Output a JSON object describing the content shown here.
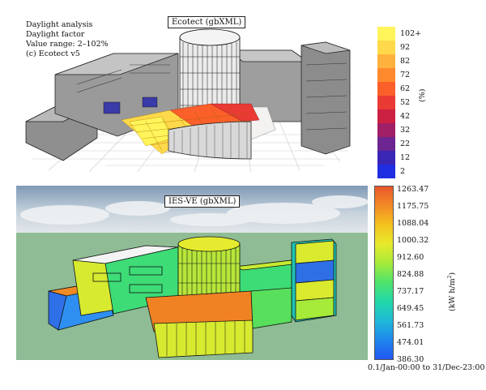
{
  "ecotect": {
    "title": "Ecotect (gbXML)",
    "info_lines": [
      "Daylight analysis",
      "Daylight factor",
      "Value range: 2–102%",
      "(c) Ecotect v5"
    ],
    "legend": [
      {
        "label": "102+",
        "color": "#fff45a"
      },
      {
        "label": "92",
        "color": "#ffd94a"
      },
      {
        "label": "82",
        "color": "#ffb13d"
      },
      {
        "label": "72",
        "color": "#ff8a2e"
      },
      {
        "label": "62",
        "color": "#fb5f2a"
      },
      {
        "label": "52",
        "color": "#ea3a34"
      },
      {
        "label": "42",
        "color": "#cc2143"
      },
      {
        "label": "32",
        "color": "#a01f66"
      },
      {
        "label": "22",
        "color": "#6c2591"
      },
      {
        "label": "12",
        "color": "#3a26b5"
      },
      {
        "label": "2",
        "color": "#1f2ee0"
      }
    ],
    "unit": "(%)"
  },
  "iesve": {
    "title": "IES-VE (gbXML)",
    "scale": [
      "1263.47",
      "1175.75",
      "1088.04",
      "1000.32",
      "912.60",
      "824.88",
      "737.17",
      "649.45",
      "561.73",
      "474.01",
      "386.30"
    ],
    "unit_base": "(kW h/m",
    "unit_sup": "2",
    "unit_end": ")",
    "time_range": "0.1/Jan-00:00 to 31/Dec-23:00",
    "gradient_colors": [
      "#e8572a",
      "#f28a25",
      "#f4c21e",
      "#e6ea2b",
      "#a6ea3a",
      "#4fe36b",
      "#22d8a8",
      "#1fb9d8",
      "#1f86ec",
      "#2156f2"
    ]
  }
}
